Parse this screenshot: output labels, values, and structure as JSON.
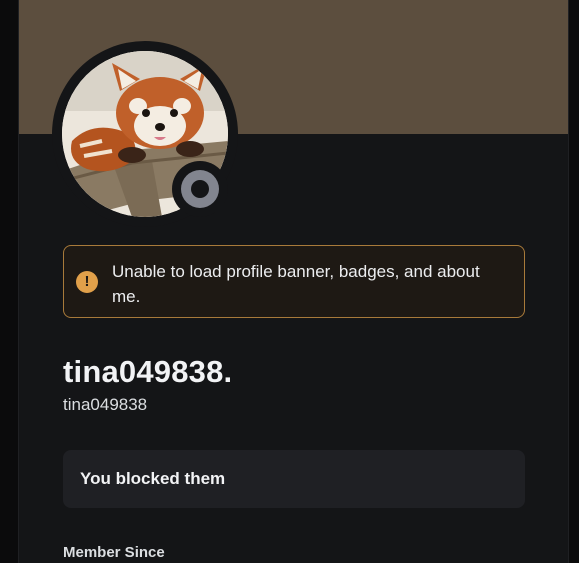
{
  "profile": {
    "display_name": "tina049838.",
    "username": "tina049838",
    "avatar_icon": "red-panda-avatar",
    "status": "offline",
    "banner_color": "#5c4e3e"
  },
  "warning": {
    "icon": "exclamation-icon",
    "message": "Unable to load profile banner, badges, and about me."
  },
  "blocked": {
    "label": "You blocked them"
  },
  "sections": {
    "member_since_label": "Member Since"
  }
}
